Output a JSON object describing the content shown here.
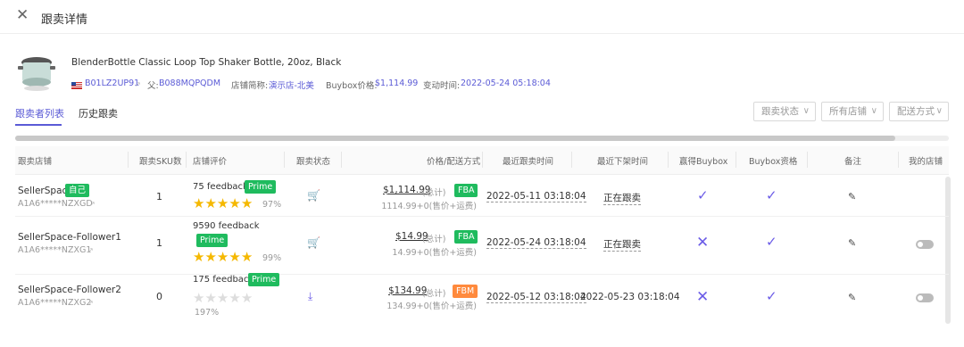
{
  "header": {
    "title": "跟卖详情"
  },
  "product": {
    "title": "BlenderBottle Classic Loop Top Shaker Bottle, 20oz, Black",
    "asin": "B01LZ2UP91",
    "parent_label": "父:",
    "parent_asin": "B088MQPQDM",
    "store_label": "店铺简称:",
    "store_name": "演示店-北美",
    "buybox_label": "Buybox价格:",
    "buybox_price": "$1,114.99",
    "change_label": "变动时间:",
    "change_time": "2022-05-24 05:18:04"
  },
  "tabs": [
    {
      "label": "跟卖者列表",
      "active": true
    },
    {
      "label": "历史跟卖",
      "active": false
    }
  ],
  "filters": [
    "跟卖状态",
    "所有店铺",
    "配送方式"
  ],
  "columns": [
    "跟卖店铺",
    "跟卖SKU数",
    "店铺评价",
    "跟卖状态",
    "价格/配送方式",
    "最近跟卖时间",
    "最近下架时间",
    "赢得Buybox",
    "Buybox资格",
    "备注",
    "我的店铺"
  ],
  "rows": [
    {
      "store": "SellerSpace",
      "tag": "自己",
      "store_id": "A1A6*****NZXGD",
      "sku_count": "1",
      "feedback": "75 feedback",
      "prime": "Prime",
      "rating": 4.5,
      "rating_pct": "97%",
      "status_icon": "cart-icon",
      "price": "$1,114.99",
      "price_note": "(总计)",
      "ship": "FBA",
      "price_detail": "1114.99+0(售价+运费)",
      "last_follow": "2022-05-11 03:18:04",
      "last_off": "正在跟卖",
      "won_buybox": true,
      "buybox_eligible": true,
      "my_store_toggle": false
    },
    {
      "store": "SellerSpace-Follower1",
      "tag": "",
      "store_id": "A1A6*****NZXG1",
      "sku_count": "1",
      "feedback": "9590 feedback",
      "prime": "Prime",
      "rating": 5,
      "rating_pct": "99%",
      "status_icon": "cart-icon",
      "price": "$14.99",
      "price_note": "(总计)",
      "ship": "FBA",
      "price_detail": "14.99+0(售价+运费)",
      "last_follow": "2022-05-24 03:18:04",
      "last_off": "正在跟卖",
      "won_buybox": false,
      "buybox_eligible": true,
      "my_store_toggle": true
    },
    {
      "store": "SellerSpace-Follower2",
      "tag": "",
      "store_id": "A1A6*****NZXG2",
      "sku_count": "0",
      "feedback": "175 feedback",
      "prime": "Prime",
      "rating": 0,
      "rating_pct": "197%",
      "status_icon": "download-icon",
      "price": "$134.99",
      "price_note": "(总计)",
      "ship": "FBM",
      "price_detail": "134.99+0(售价+运费)",
      "last_follow": "2022-05-12 03:18:04",
      "last_off": "2022-05-23 03:18:04",
      "won_buybox": false,
      "buybox_eligible": true,
      "my_store_toggle": true
    }
  ],
  "colors": {
    "accent": "#5b5bd6",
    "prime_green": "#1fbb5e",
    "fbm_orange": "#ff8a3d",
    "star": "#f5b800"
  }
}
